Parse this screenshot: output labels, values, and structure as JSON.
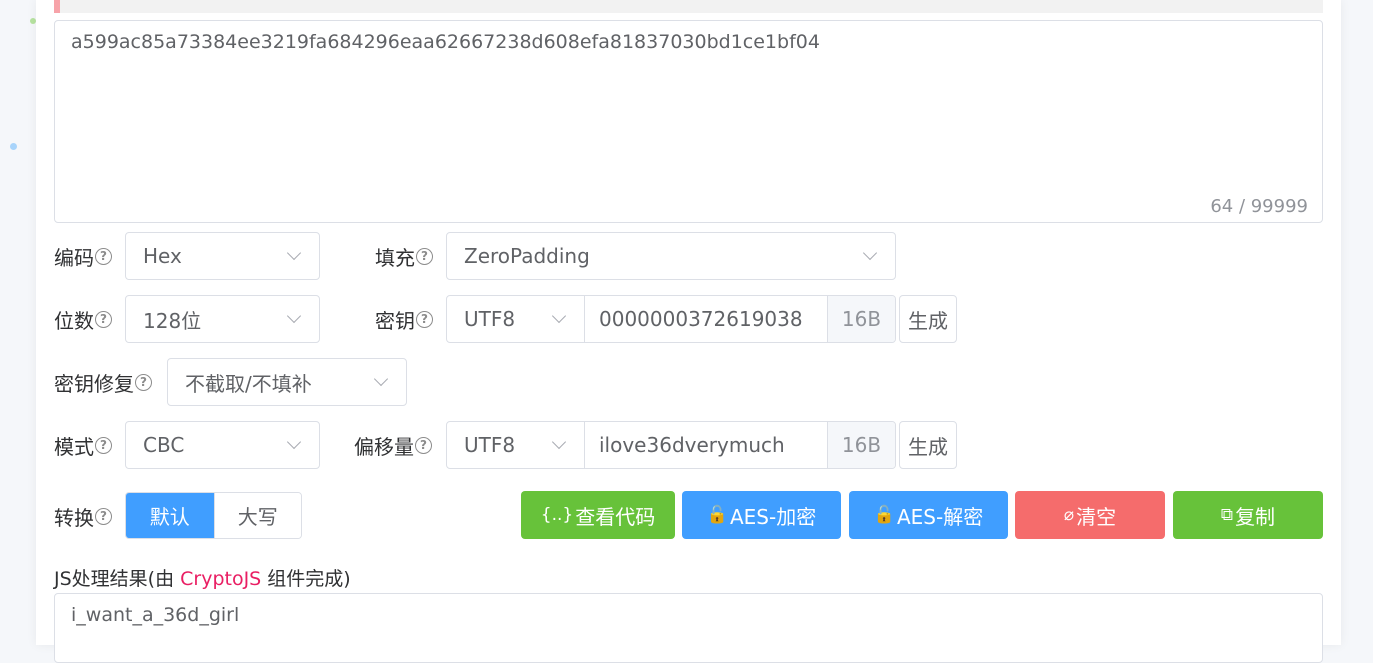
{
  "input": {
    "value": "a599ac85a73384ee3219fa684296eaa62667238d608efa81837030bd1ce1bf04",
    "counter": "64 / 99999"
  },
  "encoding": {
    "label": "编码",
    "value": "Hex"
  },
  "padding": {
    "label": "填充",
    "value": "ZeroPadding"
  },
  "bits": {
    "label": "位数",
    "value": "128位"
  },
  "key": {
    "label": "密钥",
    "charset": "UTF8",
    "value": "0000000372619038",
    "size": "16B",
    "generate_label": "生成"
  },
  "key_repair": {
    "label": "密钥修复",
    "value": "不截取/不填补"
  },
  "mode": {
    "label": "模式",
    "value": "CBC"
  },
  "iv": {
    "label": "偏移量",
    "charset": "UTF8",
    "value": "ilove36dverymuch",
    "size": "16B",
    "generate_label": "生成"
  },
  "convert": {
    "label": "转换",
    "options": [
      "默认",
      "大写"
    ],
    "selected": "默认"
  },
  "buttons": {
    "view_code": {
      "icon": "{..}",
      "label": "查看代码",
      "color": "#67c23a"
    },
    "encrypt": {
      "icon": "🔓",
      "label": "AES-加密",
      "color": "#409eff"
    },
    "decrypt": {
      "icon": "🔓",
      "label": "AES-解密",
      "color": "#409eff"
    },
    "clear": {
      "icon": "⌀",
      "label": "清空",
      "color": "#f56c6c"
    },
    "copy": {
      "icon": "⧉",
      "label": "复制",
      "color": "#67c23a"
    }
  },
  "result": {
    "label_prefix": "JS处理结果(由 ",
    "label_lib": "CryptoJS",
    "label_suffix": " 组件完成)",
    "value": "i_want_a_36d_girl"
  }
}
